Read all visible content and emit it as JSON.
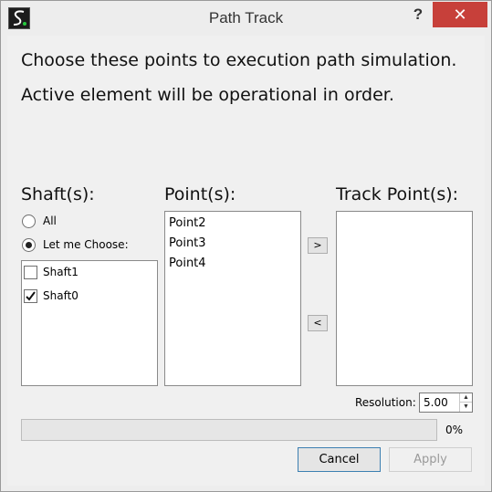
{
  "window": {
    "title": "Path Track",
    "help_label": "?",
    "close_label": "✕"
  },
  "message": {
    "line1": "Choose these points to execution path simulation.",
    "line2": "Active element will be operational in order."
  },
  "shafts": {
    "title": "Shaft(s):",
    "radio_all": "All",
    "radio_choose": "Let me Choose:",
    "selected_radio": "Let me Choose:",
    "items": [
      {
        "label": "Shaft1",
        "checked": false
      },
      {
        "label": "Shaft0",
        "checked": true
      }
    ]
  },
  "points": {
    "title": "Point(s):",
    "items": [
      "Point2",
      "Point3",
      "Point4"
    ]
  },
  "track_points": {
    "title": "Track Point(s):",
    "items": []
  },
  "transfer": {
    "add_label": ">",
    "remove_label": "<"
  },
  "resolution": {
    "label": "Resolution:",
    "value": "5.00"
  },
  "progress": {
    "value": 0,
    "text": "0%"
  },
  "buttons": {
    "cancel": "Cancel",
    "apply": "Apply"
  },
  "colors": {
    "close_button": "#c7403a",
    "cancel_border": "#3c7fb1"
  }
}
